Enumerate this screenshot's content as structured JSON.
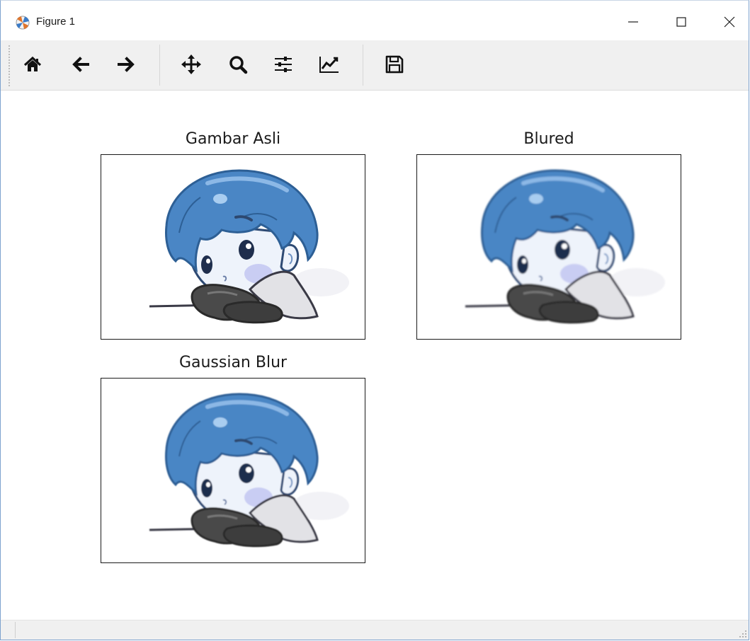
{
  "window": {
    "title": "Figure 1",
    "controls": [
      "minimize",
      "maximize",
      "close"
    ]
  },
  "toolbar": {
    "buttons": [
      {
        "name": "home",
        "icon": "home-icon"
      },
      {
        "name": "back",
        "icon": "arrow-left-icon"
      },
      {
        "name": "forward",
        "icon": "arrow-right-icon"
      },
      {
        "name": "pan",
        "icon": "move-icon"
      },
      {
        "name": "zoom",
        "icon": "magnifier-icon"
      },
      {
        "name": "configure-subplots",
        "icon": "sliders-icon"
      },
      {
        "name": "edit-axes",
        "icon": "line-chart-icon"
      },
      {
        "name": "save",
        "icon": "floppy-disk-icon"
      }
    ]
  },
  "figure": {
    "subplots": [
      {
        "title": "Gambar Asli",
        "image": "chibi-boy-illustration",
        "blur": "none"
      },
      {
        "title": "Blured",
        "image": "chibi-boy-illustration",
        "blur": "average"
      },
      {
        "title": "Gaussian Blur",
        "image": "chibi-boy-illustration",
        "blur": "gaussian"
      }
    ]
  },
  "colors": {
    "window_border": "#7da2ce",
    "toolbar_bg": "#f0f0f0",
    "hair_blue": "#4a86c5",
    "hair_dark": "#2d5f95",
    "skin": "#eef3fb",
    "cheek": "#c9cdf3",
    "arms_dark": "#4a4a4a",
    "sleeve": "#e2e2e6"
  }
}
